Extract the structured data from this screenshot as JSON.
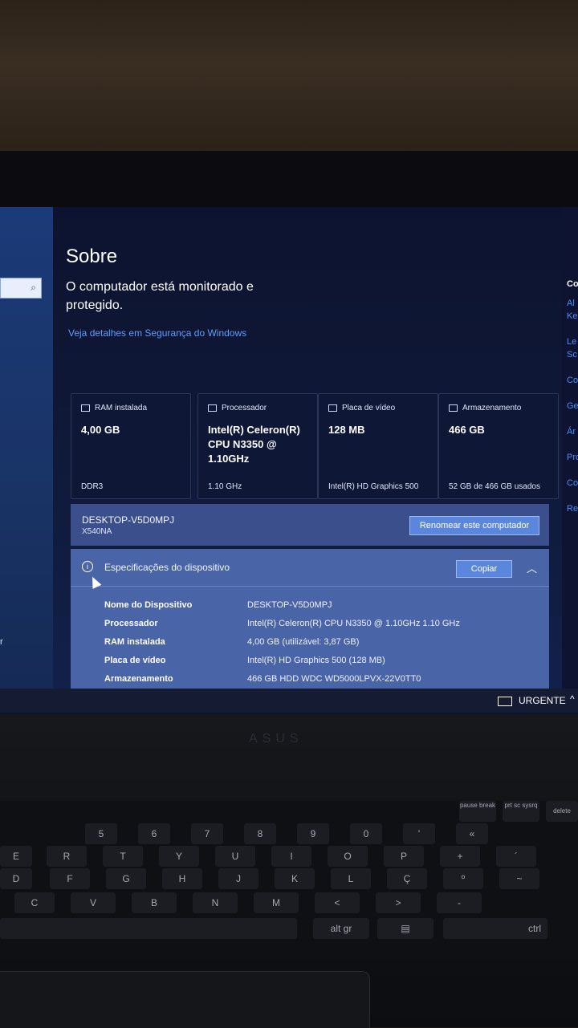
{
  "page": {
    "title": "Sobre",
    "subtitle": "O computador está monitorado e protegido.",
    "security_link": "Veja detalhes em Segurança do Windows"
  },
  "cards": [
    {
      "label": "RAM instalada",
      "value": "4,00 GB",
      "footer": "DDR3",
      "icon": "ram-icon"
    },
    {
      "label": "Processador",
      "value": "Intel(R) Celeron(R) CPU N3350 @ 1.10GHz",
      "footer": "1.10 GHz",
      "icon": "processor-icon"
    },
    {
      "label": "Placa de vídeo",
      "value": "128 MB",
      "footer": "Intel(R) HD Graphics 500",
      "icon": "gpu-icon"
    },
    {
      "label": "Armazenamento",
      "value": "466 GB",
      "footer": "52 GB de 466 GB usados",
      "icon": "storage-icon"
    }
  ],
  "computer": {
    "name": "DESKTOP-V5D0MPJ",
    "model": "X540NA",
    "rename_label": "Renomear este computador"
  },
  "specs": {
    "title": "Especificações do dispositivo",
    "copy_label": "Copiar",
    "rows": [
      {
        "key": "Nome do Dispositivo",
        "value": "DESKTOP-V5D0MPJ"
      },
      {
        "key": "Processador",
        "value": "Intel(R) Celeron(R) CPU N3350 @ 1.10GHz   1.10 GHz"
      },
      {
        "key": "RAM instalada",
        "value": "4,00 GB (utilizável: 3,87 GB)"
      },
      {
        "key": "Placa de vídeo",
        "value": "Intel(R) HD Graphics 500 (128 MB)"
      },
      {
        "key": "Armazenamento",
        "value": "466 GB HDD WDC WD5000LPVX-22V0TT0"
      }
    ]
  },
  "right_links": [
    "Co",
    "Al",
    "Ke",
    "Le",
    "Sc",
    "Co",
    "Ge",
    "Ár",
    "Pro",
    "Co",
    "Rer"
  ],
  "sidebar": {
    "partial_text": "r"
  },
  "taskbar": {
    "item_label": "URGENTE"
  },
  "keyboard": {
    "row1": [
      "pause break",
      "prt sc sysrq",
      "delete"
    ],
    "row2": [
      "5",
      "6",
      "7",
      "8",
      "9",
      "0",
      "'",
      "«"
    ],
    "row3": [
      "E",
      "R",
      "T",
      "Y",
      "U",
      "I",
      "O",
      "P",
      "+",
      "´"
    ],
    "row4": [
      "D",
      "F",
      "G",
      "H",
      "J",
      "K",
      "L",
      "Ç",
      "º",
      "~"
    ],
    "row5": [
      "C",
      "V",
      "B",
      "N",
      "M",
      "<",
      ">",
      "-"
    ],
    "row6": [
      "alt gr",
      "ctrl"
    ]
  }
}
